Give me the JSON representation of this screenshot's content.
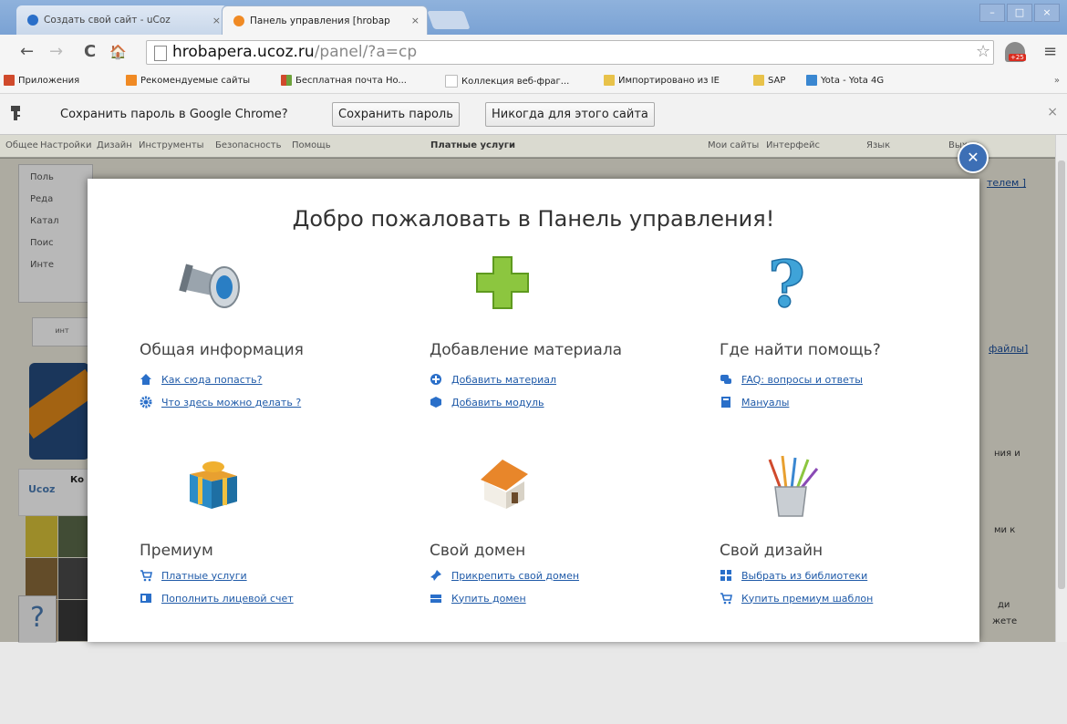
{
  "browser": {
    "tabs": [
      {
        "title": "Создать свой сайт - uCoz",
        "close": "×",
        "favicon_color": "#2a6fc9"
      },
      {
        "title": "Панель управления [hrobap",
        "close": "×",
        "favicon_color": "#f08a24"
      }
    ],
    "window_buttons": [
      "–",
      "□",
      "×"
    ],
    "nav": {
      "back": "←",
      "forward": "→",
      "reload": "C",
      "home": "🏠"
    },
    "url_host": "hrobapera.ucoz.ru",
    "url_path": "/panel/?a=cp",
    "star": "☆",
    "ext_badge": "+25",
    "menu": "≡",
    "bookmarks": [
      {
        "label": "Приложения",
        "color": "#d04a2c",
        "icon": "apps-icon"
      },
      {
        "label": "Рекомендуемые сайты",
        "color": "#f08a24",
        "icon": "bookmark-icon"
      },
      {
        "label": "Бесплатная почта Ho...",
        "color": "#6da13b",
        "icon": "mail-icon"
      },
      {
        "label": "Коллекция веб-фраг...",
        "color": "#cccccc",
        "icon": "page-icon"
      },
      {
        "label": "Импортировано из IE",
        "color": "#e8c24a",
        "icon": "folder-icon"
      },
      {
        "label": "SAP",
        "color": "#e8c24a",
        "icon": "folder-icon"
      },
      {
        "label": "Yota - Yota 4G",
        "color": "#3a87d1",
        "icon": "yota-icon"
      }
    ],
    "bookmarks_more": "»",
    "password_bar": {
      "text": "Сохранить пароль в Google Chrome?",
      "save": "Сохранить пароль",
      "never": "Никогда для этого сайта",
      "close": "×"
    }
  },
  "site": {
    "menu": [
      "Общее",
      "Настройки",
      "Дизайн",
      "Инструменты",
      "Безопасность",
      "Помощь",
      "Платные услуги"
    ],
    "menu_right": [
      "Мои сайты",
      "Интерфейс",
      "Язык",
      "Выход"
    ],
    "side_items": [
      "Поль",
      "Реда",
      "Катал",
      "Поис",
      "Инте"
    ],
    "side_link": "инт",
    "right_links": [
      "телем ]",
      "файлы]"
    ],
    "right_texts": [
      "ния и",
      "ми к",
      "ди",
      "жете"
    ],
    "ucoz_logo": "Ucoz",
    "ucoz_title": "Ко",
    "help_q": "?"
  },
  "modal": {
    "close": "✕",
    "title": "Добро пожаловать в Панель управления!",
    "sections": [
      {
        "heading": "Общая информация",
        "icon": "megaphone-icon",
        "links": [
          {
            "text": "Как сюда попасть?",
            "icon": "home-icon"
          },
          {
            "text": "Что здесь можно делать ?",
            "icon": "gear-icon"
          }
        ]
      },
      {
        "heading": "Добавление материала",
        "icon": "plus-icon",
        "links": [
          {
            "text": "Добавить материал",
            "icon": "add-circle-icon"
          },
          {
            "text": "Добавить модуль",
            "icon": "cube-icon"
          }
        ]
      },
      {
        "heading": "Где найти помощь?",
        "icon": "question-icon",
        "links": [
          {
            "text": "FAQ: вопросы и ответы",
            "icon": "chat-icon"
          },
          {
            "text": "Мануалы",
            "icon": "book-icon"
          }
        ]
      },
      {
        "heading": "Премиум",
        "icon": "gift-icon",
        "links": [
          {
            "text": "Платные услуги",
            "icon": "cart-icon"
          },
          {
            "text": "Пополнить лицевой счет",
            "icon": "wallet-icon"
          }
        ]
      },
      {
        "heading": "Свой домен",
        "icon": "house-icon",
        "links": [
          {
            "text": "Прикрепить свой домен",
            "icon": "pin-icon"
          },
          {
            "text": "Купить домен",
            "icon": "server-icon"
          }
        ]
      },
      {
        "heading": "Свой дизайн",
        "icon": "brushes-icon",
        "links": [
          {
            "text": "Выбрать из библиотеки",
            "icon": "grid-icon"
          },
          {
            "text": "Купить премиум шаблон",
            "icon": "cart-icon"
          }
        ]
      }
    ]
  }
}
